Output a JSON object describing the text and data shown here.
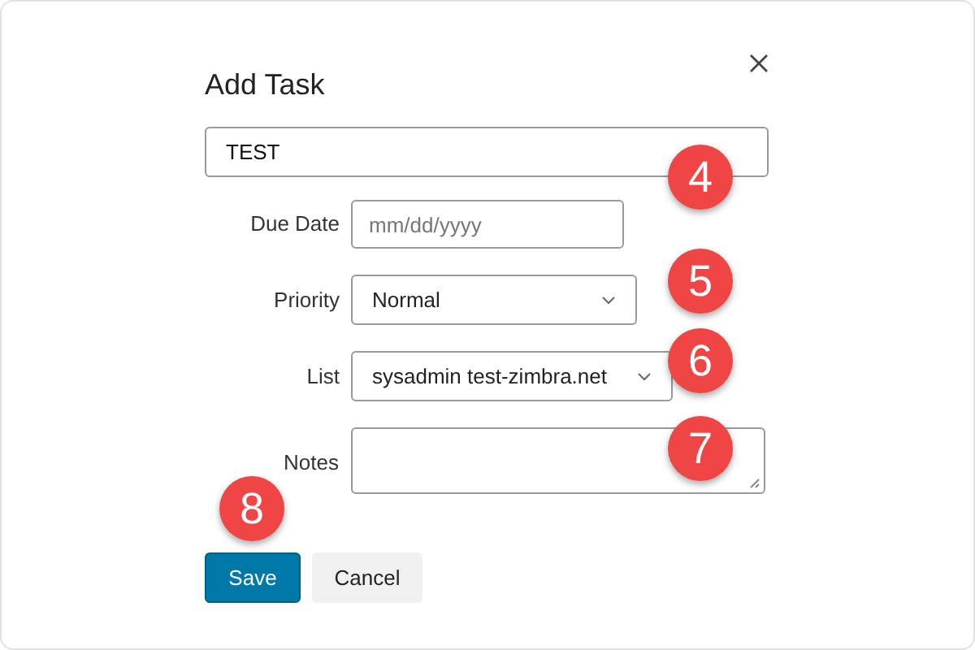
{
  "dialog": {
    "title": "Add Task",
    "title_field": {
      "value": "TEST"
    },
    "fields": [
      {
        "kind": "date",
        "label": "Due Date",
        "placeholder": "mm/dd/yyyy"
      },
      {
        "kind": "select",
        "label": "Priority",
        "value": "Normal"
      },
      {
        "kind": "select",
        "label": "List",
        "value": "sysadmin test-zimbra.net"
      },
      {
        "kind": "textarea",
        "label": "Notes"
      }
    ],
    "buttons": [
      {
        "label": "Save",
        "kind": "primary"
      },
      {
        "label": "Cancel",
        "kind": "secondary"
      }
    ]
  },
  "callouts": [
    "4",
    "5",
    "6",
    "7",
    "8"
  ]
}
